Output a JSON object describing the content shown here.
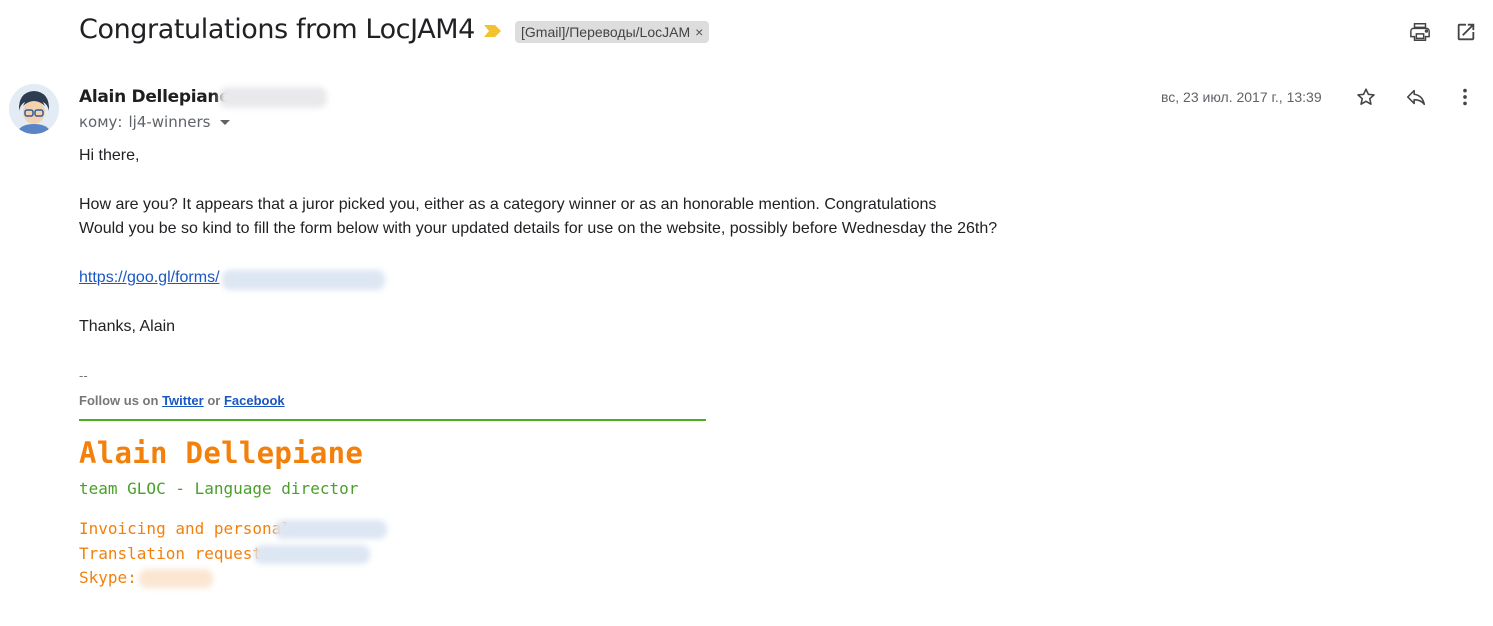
{
  "subject": "Congratulations from LocJAM4",
  "label_chip": {
    "text": "[Gmail]/Переводы/LocJAM",
    "remove": "×"
  },
  "toolbar": {
    "print_icon": "print-icon",
    "popout_icon": "open-in-new-window-icon"
  },
  "sender": {
    "name": "Alain Dellepiane",
    "to_prefix": "кому:",
    "to_value": "lj4-winners"
  },
  "date": "вс, 23 июл. 2017 г., 13:39",
  "actions": {
    "star_icon": "star-icon",
    "reply_icon": "reply-icon",
    "more_icon": "more-vert-icon"
  },
  "body": {
    "greeting": "Hi there,",
    "line1": "How are you? It appears that a juror picked you, either as a category winner or as an honorable mention. Congratulations",
    "line2": "Would you be so kind to fill the form below with your updated details for use on the website, possibly before Wednesday the 26th?",
    "link_prefix": "https://goo.gl/forms/",
    "signoff": "Thanks, Alain"
  },
  "signature": {
    "dashes": "--",
    "follow_prefix": "Follow us on",
    "twitter": "Twitter",
    "or": "or",
    "facebook": "Facebook",
    "name": "Alain Dellepiane",
    "role": "team GLOC - Language director",
    "invoicing_label": "Invoicing and personal:",
    "translation_label": "Translation requests:",
    "skype_label": "Skype:"
  },
  "colors": {
    "link": "#1a57c2",
    "signature_orange": "#f4800c",
    "signature_green": "#4aa02a",
    "important_marker": "#f2c230"
  }
}
